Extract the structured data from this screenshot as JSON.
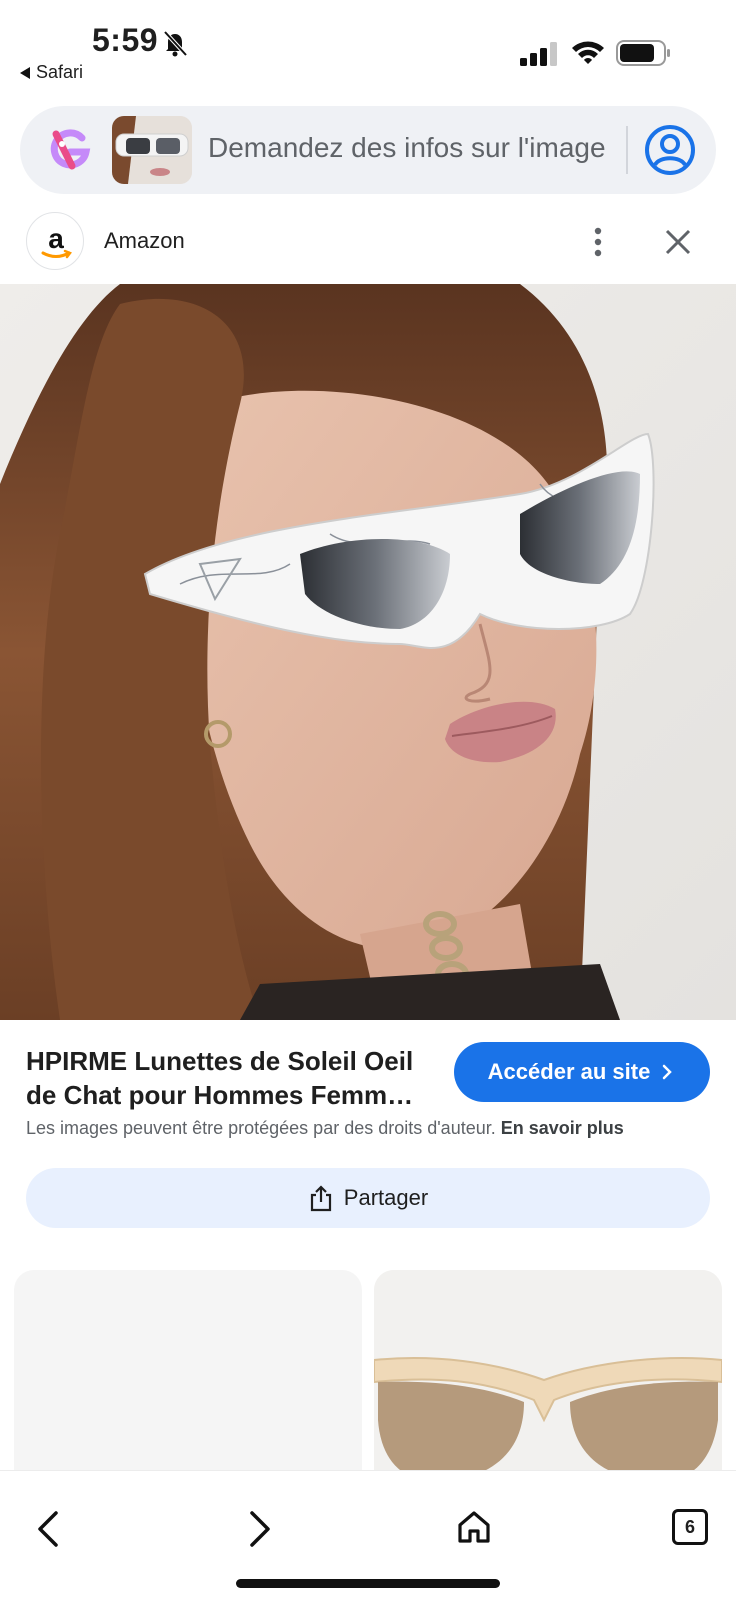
{
  "status_bar": {
    "time": "5:59",
    "back_app": "Safari"
  },
  "search": {
    "placeholder": "Demandez des infos sur l'image"
  },
  "source": {
    "name": "Amazon"
  },
  "product": {
    "title": "HPIRME Lunettes de Soleil Oeil de Chat pour Hommes Femm…",
    "cta_label": "Accéder au site",
    "copyright_text": "Les images peuvent être protégées par des droits d'auteur.",
    "learn_more": "En savoir plus",
    "share_label": "Partager"
  },
  "toolbar": {
    "tab_count": "6"
  },
  "colors": {
    "accent": "#1a73e8",
    "share_bg": "#e8f0fe",
    "search_bg": "#eff1f5"
  },
  "icons": [
    "bell-off-icon",
    "signal-icon",
    "wifi-icon",
    "battery-icon",
    "google-lens-icon",
    "account-icon",
    "amazon-logo",
    "more-vert-icon",
    "close-icon",
    "chevron-right-icon",
    "share-icon",
    "back-icon",
    "forward-icon",
    "home-icon",
    "tabs-icon"
  ]
}
